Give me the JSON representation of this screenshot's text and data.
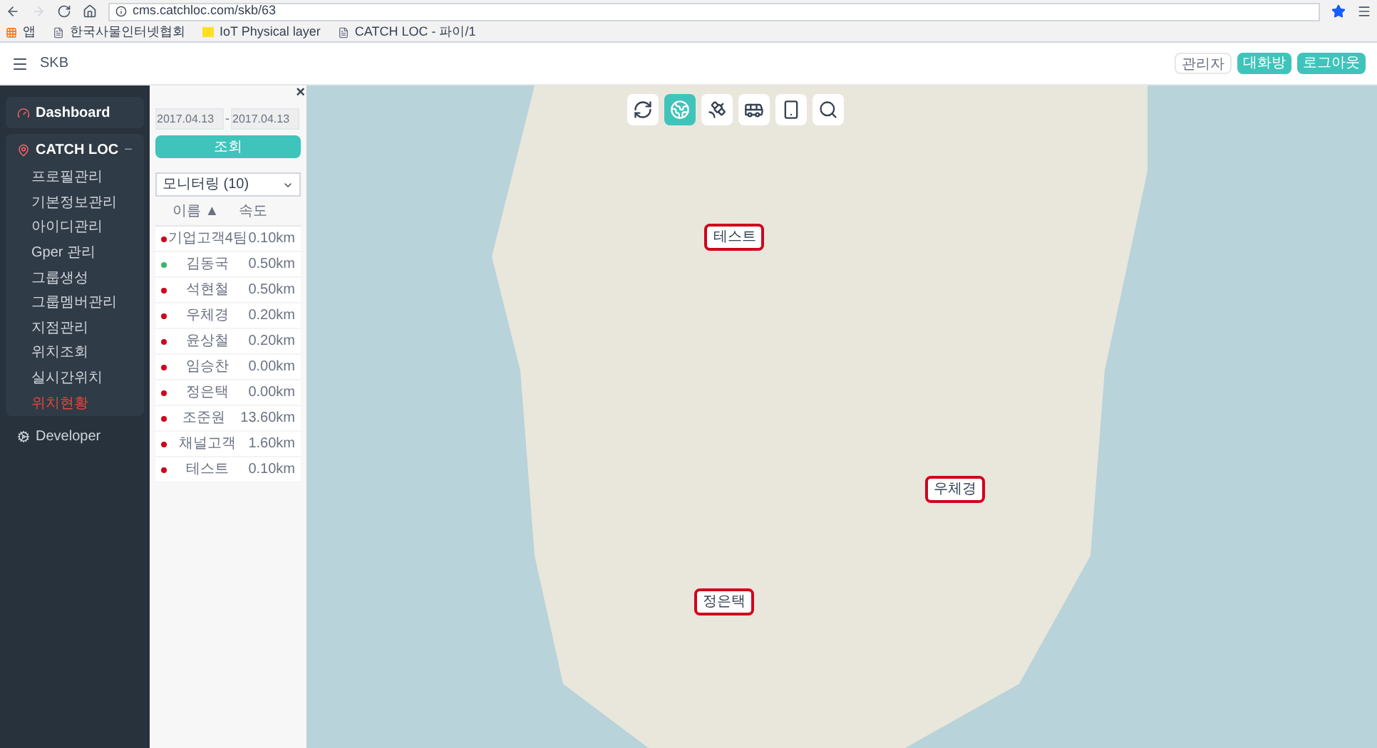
{
  "browser": {
    "url": "cms.catchloc.com/skb/63",
    "bookmarks": [
      {
        "kind": "apps",
        "label": "앱"
      },
      {
        "kind": "page",
        "label": "한국사물인터넷협회"
      },
      {
        "kind": "logo",
        "label": "IoT Physical layer"
      },
      {
        "kind": "page",
        "label": "CATCH LOC - 파이/1"
      }
    ]
  },
  "header": {
    "title": "SKB",
    "buttons": [
      {
        "label": "관리자",
        "primary": false
      },
      {
        "label": "대화방",
        "primary": true
      },
      {
        "label": "로그아웃",
        "primary": true
      }
    ]
  },
  "sidebar": {
    "items": [
      {
        "kind": "dashboard",
        "label": "Dashboard"
      },
      {
        "kind": "pin",
        "label": "CATCH LOC",
        "expanded": true,
        "toggle": "−",
        "children": [
          {
            "label": "프로필관리",
            "selected": false
          },
          {
            "label": "기본정보관리",
            "selected": false
          },
          {
            "label": "아이디관리",
            "selected": false
          },
          {
            "label": "Gper 관리",
            "selected": false
          },
          {
            "label": "그룹생성",
            "selected": false
          },
          {
            "label": "그룹멤버관리",
            "selected": false
          },
          {
            "label": "지점관리",
            "selected": false
          },
          {
            "label": "위치조회",
            "selected": false
          },
          {
            "label": "실시간위치",
            "selected": false
          },
          {
            "label": "위치현황",
            "selected": true
          }
        ]
      },
      {
        "kind": "gears",
        "label": "Developer"
      }
    ]
  },
  "panel": {
    "close": "×",
    "date_from": "2017.04.13",
    "date_sep": "-",
    "date_to": "2017.04.13",
    "search_button": "조회",
    "group_select": "모니터링 (10)",
    "columns": [
      "이름 ▲",
      "속도"
    ],
    "rows": [
      {
        "name": "기업고객4팀",
        "speed": "0.10km",
        "color": "#d0021b"
      },
      {
        "name": "김동국",
        "speed": "0.50km",
        "color": "#3cb371"
      },
      {
        "name": "석현철",
        "speed": "0.50km",
        "color": "#d0021b"
      },
      {
        "name": "우체경",
        "speed": "0.20km",
        "color": "#d0021b"
      },
      {
        "name": "윤상철",
        "speed": "0.20km",
        "color": "#d0021b"
      },
      {
        "name": "임승찬",
        "speed": "0.00km",
        "color": "#d0021b"
      },
      {
        "name": "정은택",
        "speed": "0.00km",
        "color": "#d0021b"
      },
      {
        "name": "조준원",
        "speed": "13.60km",
        "color": "#d0021b"
      },
      {
        "name": "채널고객",
        "speed": "1.60km",
        "color": "#d0021b"
      },
      {
        "name": "테스트",
        "speed": "0.10km",
        "color": "#d0021b"
      }
    ]
  },
  "map": {
    "tools": [
      {
        "kind": "refresh",
        "selected": false
      },
      {
        "kind": "globe",
        "selected": true
      },
      {
        "kind": "satellite",
        "selected": false
      },
      {
        "kind": "bus",
        "selected": false
      },
      {
        "kind": "tracker",
        "selected": false
      },
      {
        "kind": "search",
        "selected": false
      }
    ],
    "markers": [
      {
        "label": "테스트"
      },
      {
        "label": "우체경"
      },
      {
        "label": "정은택"
      }
    ]
  }
}
